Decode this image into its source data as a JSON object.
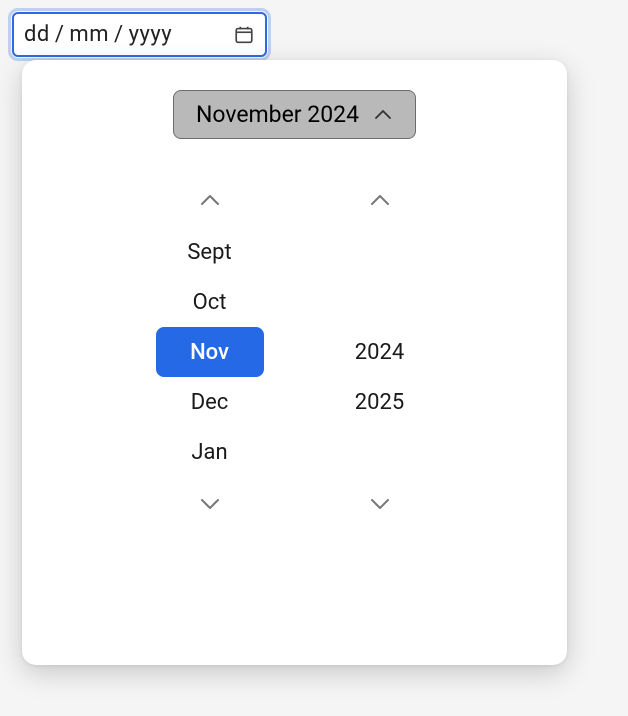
{
  "input": {
    "day_placeholder": "dd",
    "month_placeholder": "mm",
    "year_placeholder": "yyyy",
    "separator": "/"
  },
  "header": {
    "label": "November 2024"
  },
  "month_spinner": {
    "items": [
      {
        "label": "Sept",
        "selected": false
      },
      {
        "label": "Oct",
        "selected": false
      },
      {
        "label": "Nov",
        "selected": true
      },
      {
        "label": "Dec",
        "selected": false
      },
      {
        "label": "Jan",
        "selected": false
      }
    ]
  },
  "year_spinner": {
    "items": [
      {
        "label": "",
        "selected": false,
        "empty": true
      },
      {
        "label": "",
        "selected": false,
        "empty": true
      },
      {
        "label": "2024",
        "selected": false
      },
      {
        "label": "2025",
        "selected": false
      },
      {
        "label": "",
        "selected": false,
        "empty": true
      }
    ]
  }
}
